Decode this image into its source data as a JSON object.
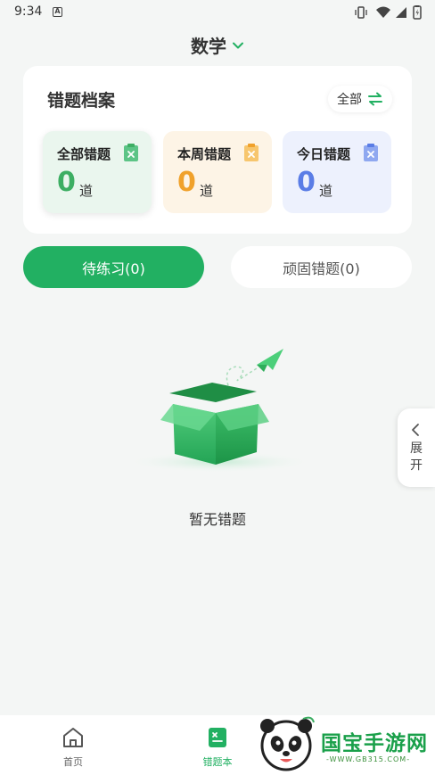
{
  "status_bar": {
    "time": "9:34",
    "notification_icon": "A"
  },
  "header": {
    "subject": "数学"
  },
  "archive": {
    "title": "错题档案",
    "filter_label": "全部",
    "stats": [
      {
        "label": "全部错题",
        "count": "0",
        "unit": "道",
        "color": "#3dae63"
      },
      {
        "label": "本周错题",
        "count": "0",
        "unit": "道",
        "color": "#f0a12b"
      },
      {
        "label": "今日错题",
        "count": "0",
        "unit": "道",
        "color": "#5a7de6"
      }
    ]
  },
  "tabs": {
    "pending": "待练习(0)",
    "review": "顽固错题(0)"
  },
  "empty_state": {
    "message": "暂无错题"
  },
  "side_panel": {
    "expand_label": "展开"
  },
  "bottom_nav": {
    "items": [
      {
        "label": "首页",
        "active": false
      },
      {
        "label": "错题本",
        "active": true
      }
    ]
  },
  "watermark": {
    "title": "国宝手游网",
    "url": "-WWW.GB315.COM-"
  },
  "colors": {
    "accent": "#22b062",
    "background": "#f4f6f5"
  }
}
